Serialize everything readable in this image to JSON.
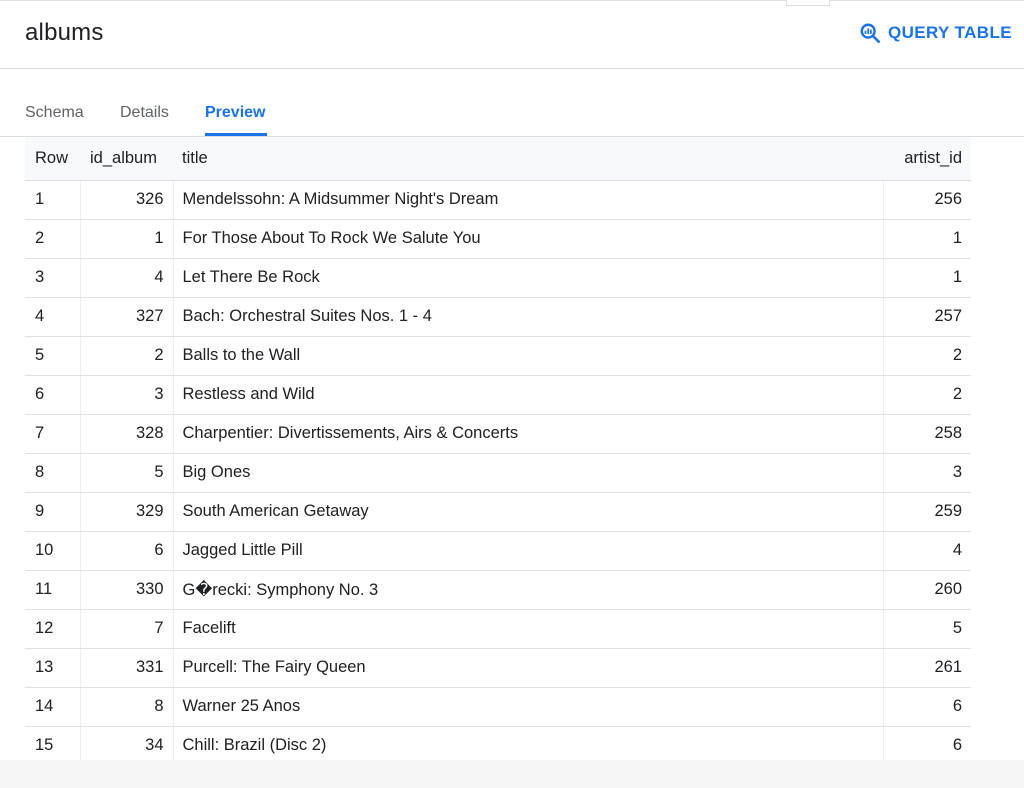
{
  "header": {
    "table_name": "albums",
    "query_label": "QUERY TABLE",
    "query_icon": "query-search-icon"
  },
  "tabs": [
    {
      "label": "Schema",
      "active": false
    },
    {
      "label": "Details",
      "active": false
    },
    {
      "label": "Preview",
      "active": true
    }
  ],
  "colors": {
    "accent": "#1a73e8",
    "text": "#202124",
    "muted": "#5f6368",
    "border": "#dadce0",
    "header_bg": "#f8f9fa"
  },
  "table": {
    "columns": [
      "Row",
      "id_album",
      "title",
      "artist_id"
    ],
    "rows": [
      [
        "1",
        "326",
        "Mendelssohn: A Midsummer Night's Dream",
        "256"
      ],
      [
        "2",
        "1",
        "For Those About To Rock We Salute You",
        "1"
      ],
      [
        "3",
        "4",
        "Let There Be Rock",
        "1"
      ],
      [
        "4",
        "327",
        "Bach: Orchestral Suites Nos. 1 - 4",
        "257"
      ],
      [
        "5",
        "2",
        "Balls to the Wall",
        "2"
      ],
      [
        "6",
        "3",
        "Restless and Wild",
        "2"
      ],
      [
        "7",
        "328",
        "Charpentier: Divertissements, Airs & Concerts",
        "258"
      ],
      [
        "8",
        "5",
        "Big Ones",
        "3"
      ],
      [
        "9",
        "329",
        "South American Getaway",
        "259"
      ],
      [
        "10",
        "6",
        "Jagged Little Pill",
        "4"
      ],
      [
        "11",
        "330",
        "G�recki: Symphony No. 3",
        "260"
      ],
      [
        "12",
        "7",
        "Facelift",
        "5"
      ],
      [
        "13",
        "331",
        "Purcell: The Fairy Queen",
        "261"
      ],
      [
        "14",
        "8",
        "Warner 25 Anos",
        "6"
      ],
      [
        "15",
        "34",
        "Chill: Brazil (Disc 2)",
        "6"
      ]
    ]
  }
}
